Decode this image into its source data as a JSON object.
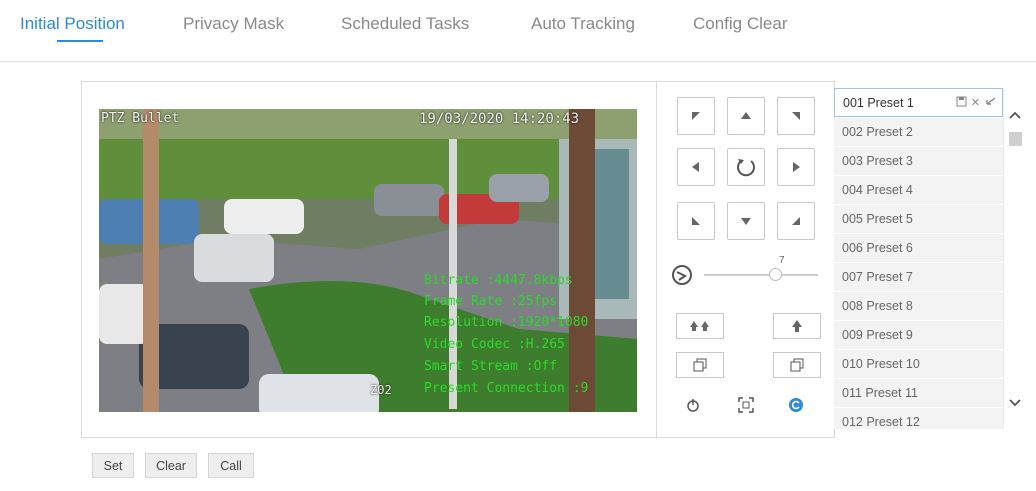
{
  "tabs": [
    {
      "label": "Initial Position",
      "active": true
    },
    {
      "label": "Privacy Mask",
      "active": false
    },
    {
      "label": "Scheduled Tasks",
      "active": false
    },
    {
      "label": "Auto Tracking",
      "active": false
    },
    {
      "label": "Config Clear",
      "active": false
    }
  ],
  "video": {
    "camera_name": "PTZ Bullet",
    "timestamp": "19/03/2020 14:20:43",
    "osd_lines": [
      "Bitrate :4447.8kbps",
      "Frame Rate :25fps",
      "Resolution :1920*1080",
      "Video Codec :H.265",
      "Smart Stream :Off",
      "Present Connection :9"
    ],
    "zone_label": "Z02"
  },
  "ptz": {
    "speed_value": "7",
    "speed_level_fraction": 0.62
  },
  "presets": [
    {
      "label": "001 Preset 1",
      "selected": true
    },
    {
      "label": "002 Preset 2",
      "selected": false
    },
    {
      "label": "003 Preset 3",
      "selected": false
    },
    {
      "label": "004 Preset 4",
      "selected": false
    },
    {
      "label": "005 Preset 5",
      "selected": false
    },
    {
      "label": "006 Preset 6",
      "selected": false
    },
    {
      "label": "007 Preset 7",
      "selected": false
    },
    {
      "label": "008 Preset 8",
      "selected": false
    },
    {
      "label": "009 Preset 9",
      "selected": false
    },
    {
      "label": "010 Preset 10",
      "selected": false
    },
    {
      "label": "011 Preset 11",
      "selected": false
    },
    {
      "label": "012 Preset 12",
      "selected": false
    }
  ],
  "buttons": {
    "set": "Set",
    "clear": "Clear",
    "call": "Call"
  },
  "colors": {
    "accent": "#2f8ad9",
    "osd_green": "#2bd92b"
  }
}
